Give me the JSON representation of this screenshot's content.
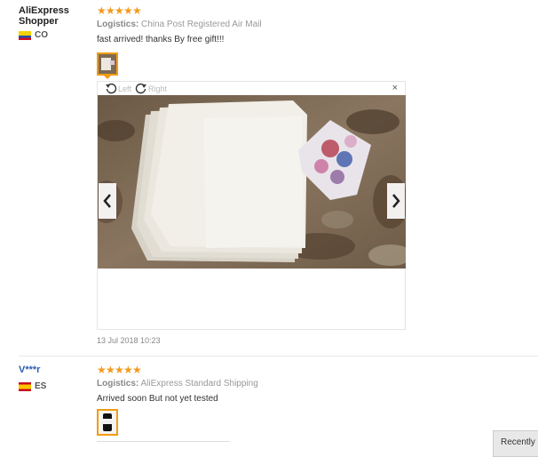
{
  "reviews": [
    {
      "user": {
        "name_line1": "AliExpress",
        "name_line2": "Shopper",
        "country": "CO"
      },
      "stars": 5,
      "logistics_label": "Logistics:",
      "logistics_value": "China Post Registered Air Mail",
      "text": "fast arrived! thanks By free gift!!!",
      "date": "13 Jul 2018 10:23"
    },
    {
      "user": {
        "name": "V***r",
        "country": "ES"
      },
      "stars": 5,
      "logistics_label": "Logistics:",
      "logistics_value": "AliExpress Standard Shipping",
      "text": "Arrived soon But not yet tested"
    }
  ],
  "viewer": {
    "rotate_left": "Left",
    "rotate_right": "Right",
    "close_symbol": "×"
  },
  "recently_button": "Recently",
  "colors": {
    "star": "#f29a1f",
    "accent_border": "#f39c12",
    "user_blue": "#2a5db0"
  }
}
